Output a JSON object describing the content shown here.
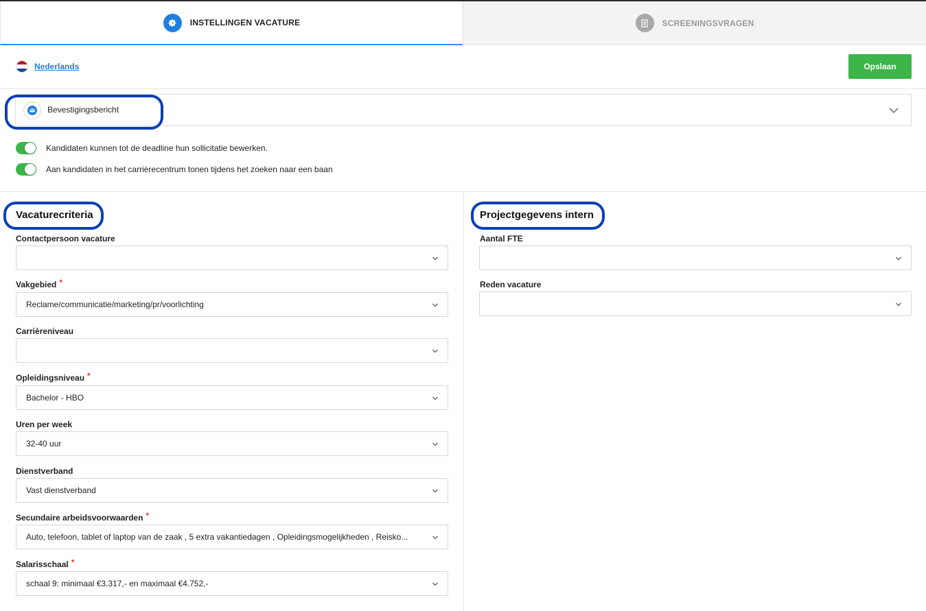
{
  "tabs": [
    {
      "label": "INSTELLINGEN VACATURE",
      "icon": "gear-icon",
      "active": true
    },
    {
      "label": "SCREENINGSVRAGEN",
      "icon": "document-icon",
      "active": false
    }
  ],
  "language": {
    "label": "Nederlands",
    "flag": "netherlands-flag-icon"
  },
  "toolbar": {
    "save_label": "Opslaan"
  },
  "confirmation": {
    "title": "Bevestigingsbericht",
    "icon": "envelope-icon"
  },
  "toggles": [
    {
      "label": "Kandidaten kunnen tot de deadline hun sollicitatie bewerken.",
      "on": true
    },
    {
      "label": "Aan kandidaten in het carrièrecentrum tonen tijdens het zoeken naar een baan",
      "on": true
    }
  ],
  "criteria": {
    "title": "Vacaturecriteria",
    "fields": [
      {
        "label": "Contactpersoon vacature",
        "required": false,
        "value": ""
      },
      {
        "label": "Vakgebied",
        "required": true,
        "value": "Reclame/communicatie/marketing/pr/voorlichting"
      },
      {
        "label": "Carrièreniveau",
        "required": false,
        "value": ""
      },
      {
        "label": "Opleidingsniveau",
        "required": true,
        "value": "Bachelor - HBO"
      },
      {
        "label": "Uren per week",
        "required": false,
        "value": "32-40 uur"
      },
      {
        "label": "Dienstverband",
        "required": false,
        "value": "Vast dienstverband"
      },
      {
        "label": "Secundaire arbeidsvoorwaarden",
        "required": true,
        "value": "Auto, telefoon, tablet of laptop van de zaak , 5 extra vakantiedagen , Opleidingsmogelijkheden , Reisko..."
      },
      {
        "label": "Salarisschaal",
        "required": true,
        "value": "schaal 9: minimaal €3.317,- en maximaal €4.752,-"
      }
    ]
  },
  "project": {
    "title": "Projectgegevens intern",
    "fields": [
      {
        "label": "Aantal FTE",
        "required": false,
        "value": ""
      },
      {
        "label": "Reden vacature",
        "required": false,
        "value": ""
      }
    ]
  },
  "required_marker": "*",
  "colors": {
    "accent": "#1f7fe0",
    "save_button": "#3cb54a",
    "toggle_on": "#3cb54a",
    "highlight_ring": "#0b3fb5",
    "required": "#e53935",
    "inactive_tab_bg": "#f3f3f3"
  }
}
